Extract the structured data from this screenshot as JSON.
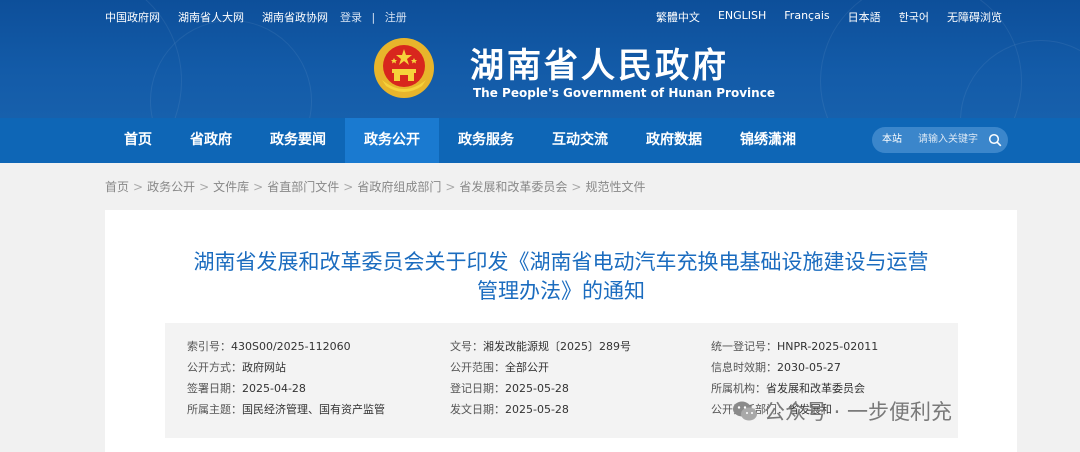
{
  "utility": {
    "links": [
      "中国政府网",
      "湖南省人大网",
      "湖南省政协网"
    ],
    "login": "登录",
    "register": "注册",
    "divider": "|",
    "languages": [
      "繁體中文",
      "ENGLISH",
      "Français",
      "日本語",
      "한국어",
      "无障碍浏览"
    ]
  },
  "header": {
    "title": "湖南省人民政府",
    "subtitle": "The People's Government of Hunan Province"
  },
  "nav": {
    "items": [
      "首页",
      "省政府",
      "政务要闻",
      "政务公开",
      "政务服务",
      "互动交流",
      "政府数据",
      "锦绣潇湘"
    ],
    "active_index": 3,
    "search_label": "本站",
    "search_placeholder": "请输入关键字"
  },
  "breadcrumb": [
    "首页",
    "政务公开",
    "文件库",
    "省直部门文件",
    "省政府组成部门",
    "省发展和改革委员会",
    "规范性文件"
  ],
  "breadcrumb_sep": ">",
  "article": {
    "title_line1": "湖南省发展和改革委员会关于印发《湖南省电动汽车充换电基础设施建设与运营",
    "title_line2": "管理办法》的通知"
  },
  "meta": {
    "col1": [
      {
        "k": "索引号：",
        "v": "430S00/2025-112060"
      },
      {
        "k": "公开方式：",
        "v": "政府网站"
      },
      {
        "k": "签署日期：",
        "v": "2025-04-28"
      },
      {
        "k": "所属主题：",
        "v": "国民经济管理、国有资产监管"
      }
    ],
    "col2": [
      {
        "k": "文号：",
        "v": "湘发改能源规〔2025〕289号"
      },
      {
        "k": "公开范围：",
        "v": "全部公开"
      },
      {
        "k": "登记日期：",
        "v": "2025-05-28"
      },
      {
        "k": "发文日期：",
        "v": "2025-05-28"
      }
    ],
    "col3": [
      {
        "k": "统一登记号：",
        "v": "HNPR-2025-02011"
      },
      {
        "k": "信息时效期：",
        "v": "2030-05-27"
      },
      {
        "k": "所属机构：",
        "v": "省发展和改革委员会"
      },
      {
        "k": "公开责任部门：",
        "v": "省发展和"
      }
    ]
  },
  "watermark": "公众号 · 一步便利充",
  "colors": {
    "header": "#135ba8",
    "nav": "#0e66b6",
    "nav_active": "#1a7ad0",
    "title": "#1b6cbf"
  }
}
